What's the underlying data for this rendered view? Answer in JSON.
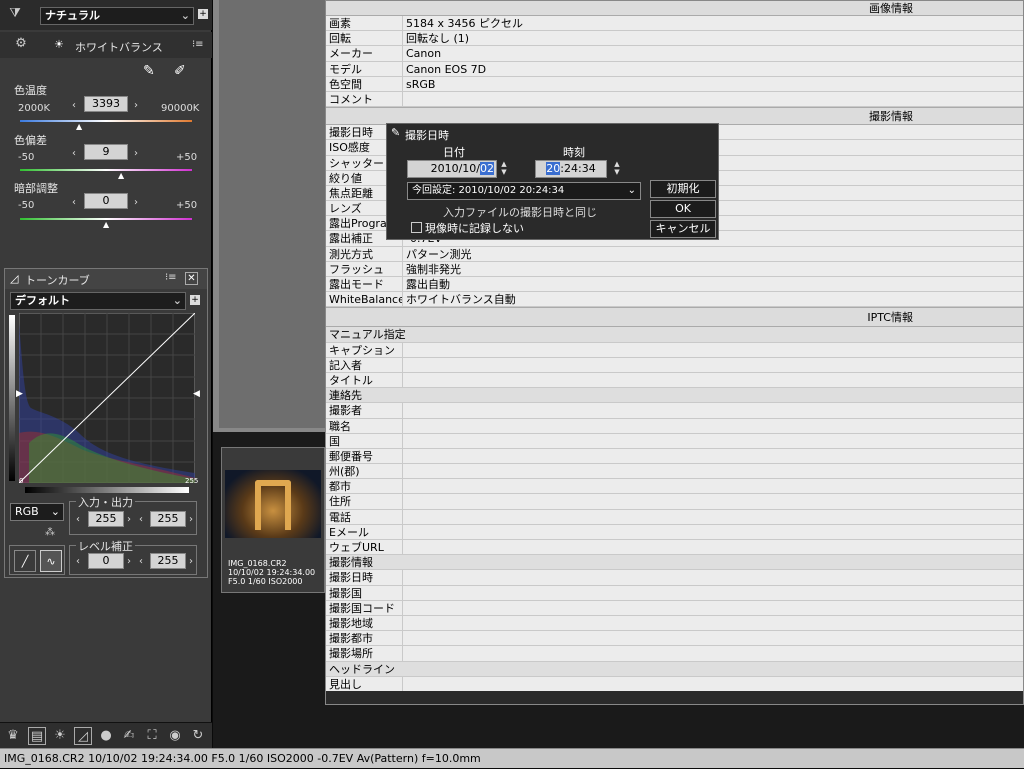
{
  "left": {
    "picture_style": "ナチュラル",
    "wb_title": "ホワイトバランス",
    "color_temp": {
      "label": "色温度",
      "min": "2000K",
      "value": "3393",
      "max": "90000K"
    },
    "tint": {
      "label": "色偏差",
      "min": "-50",
      "value": "9",
      "max": "+50"
    },
    "shadow": {
      "label": "暗部調整",
      "min": "-50",
      "value": "0",
      "max": "+50"
    },
    "tone_title": "トーンカーブ",
    "tone_preset": "デフォルト",
    "channel": "RGB",
    "io_label": "入力・出力",
    "io_in": "255",
    "io_out": "255",
    "level_label": "レベル補正",
    "level_min": "0",
    "level_max": "255",
    "curve_tick_max": "255",
    "curve_tick_min": "0"
  },
  "thumb": {
    "filename": "IMG_0168.CR2",
    "datetime": "10/10/02 19:24:34.00",
    "exposure": "F5.0 1/60 ISO2000"
  },
  "info": {
    "sections": {
      "image": "画像情報",
      "shooting": "撮影情報",
      "iptc": "IPTC情報"
    },
    "image_rows": [
      {
        "k": "画素",
        "v": "5184 x 3456 ピクセル"
      },
      {
        "k": "回転",
        "v": "回転なし (1)"
      },
      {
        "k": "メーカー",
        "v": "Canon"
      },
      {
        "k": "モデル",
        "v": "Canon EOS 7D"
      },
      {
        "k": "色空間",
        "v": "sRGB"
      },
      {
        "k": "コメント",
        "v": ""
      }
    ],
    "shooting_rows": [
      {
        "k": "撮影日時",
        "v": ""
      },
      {
        "k": "ISO感度",
        "v": ""
      },
      {
        "k": "シャッター",
        "v": ""
      },
      {
        "k": "絞り値",
        "v": ""
      },
      {
        "k": "焦点距離",
        "v": ""
      },
      {
        "k": "レンズ",
        "v": ""
      },
      {
        "k": "露出Program",
        "v": ""
      },
      {
        "k": "露出補正",
        "v": "-0.7EV"
      },
      {
        "k": "測光方式",
        "v": "パターン測光"
      },
      {
        "k": "フラッシュ",
        "v": "強制非発光"
      },
      {
        "k": "露出モード",
        "v": "露出自動"
      },
      {
        "k": "WhiteBalance",
        "v": "ホワイトバランス自動"
      }
    ],
    "iptc_rows": [
      {
        "k": "マニュアル指定",
        "v": "",
        "sub": true
      },
      {
        "k": "キャプション",
        "v": ""
      },
      {
        "k": "記入者",
        "v": ""
      },
      {
        "k": "タイトル",
        "v": ""
      },
      {
        "k": "連絡先",
        "v": "",
        "sub": true
      },
      {
        "k": "撮影者",
        "v": ""
      },
      {
        "k": "職名",
        "v": ""
      },
      {
        "k": "国",
        "v": ""
      },
      {
        "k": "郵便番号",
        "v": ""
      },
      {
        "k": "州(郡)",
        "v": ""
      },
      {
        "k": "都市",
        "v": ""
      },
      {
        "k": "住所",
        "v": ""
      },
      {
        "k": "電話",
        "v": ""
      },
      {
        "k": "Eメール",
        "v": ""
      },
      {
        "k": "ウェブURL",
        "v": ""
      },
      {
        "k": "撮影情報",
        "v": "",
        "sub": true
      },
      {
        "k": "撮影日時",
        "v": ""
      },
      {
        "k": "撮影国",
        "v": ""
      },
      {
        "k": "撮影国コード",
        "v": ""
      },
      {
        "k": "撮影地域",
        "v": ""
      },
      {
        "k": "撮影都市",
        "v": ""
      },
      {
        "k": "撮影場所",
        "v": ""
      },
      {
        "k": "ヘッドライン",
        "v": "",
        "sub": true
      },
      {
        "k": "見出し",
        "v": ""
      }
    ]
  },
  "dialog": {
    "title": "撮影日時",
    "date_label": "日付",
    "time_label": "時刻",
    "date_prefix": "2010/10/",
    "date_sel": "02",
    "time_sel": "20",
    "time_rest": ":24:34",
    "preset": "今回設定: 2010/10/02 20:24:34",
    "preset_note": "入力ファイルの撮影日時と同じ",
    "checkbox_label": "現像時に記録しない",
    "btn_reset": "初期化",
    "btn_ok": "OK",
    "btn_cancel": "キャンセル"
  },
  "status": "IMG_0168.CR2 10/10/02 19:24:34.00 F5.0 1/60 ISO2000 -0.7EV Av(Pattern) f=10.0mm"
}
